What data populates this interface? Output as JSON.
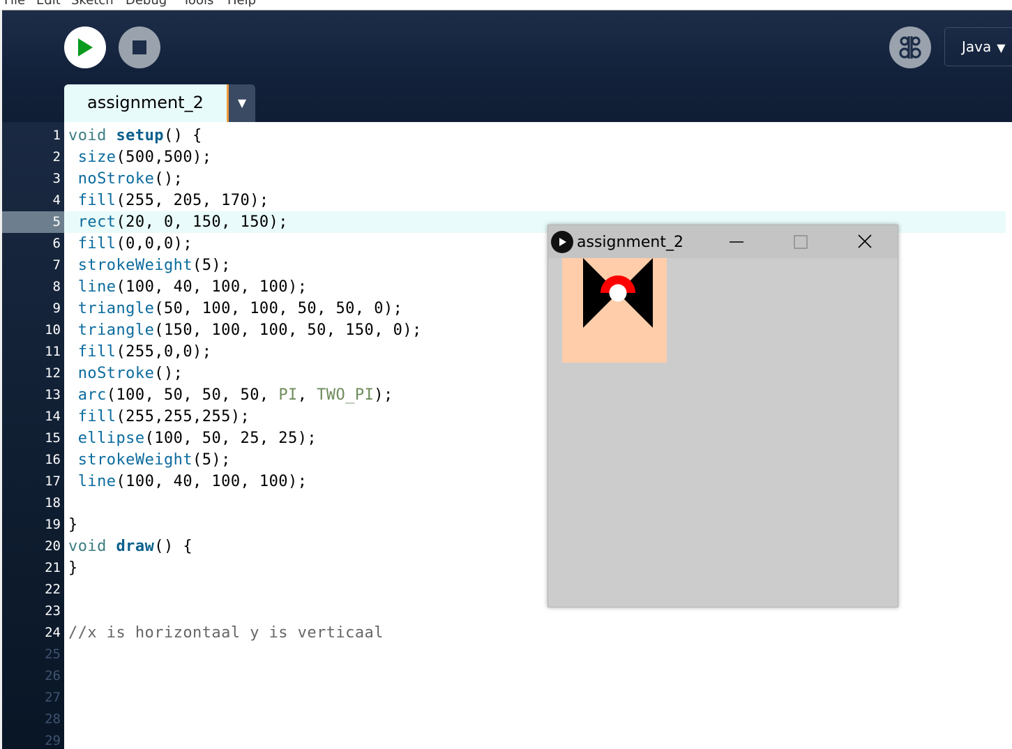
{
  "menubar": {
    "items": [
      "File",
      "Edit",
      "Sketch",
      "Debug",
      "Tools",
      "Help"
    ]
  },
  "toolbar": {
    "run_icon": "play-icon",
    "stop_icon": "stop-icon",
    "debug_icon": "butterfly-icon",
    "mode": "Java",
    "mode_arrow": "▼"
  },
  "tab": {
    "label": "assignment_2",
    "menu_arrow": "▼"
  },
  "editor": {
    "current_line": 5,
    "line_numbers": [
      "1",
      "2",
      "3",
      "4",
      "5",
      "6",
      "7",
      "8",
      "9",
      "10",
      "11",
      "12",
      "13",
      "14",
      "15",
      "16",
      "17",
      "18",
      "19",
      "20",
      "21",
      "22",
      "23",
      "24",
      "25",
      "26",
      "27",
      "28",
      "29"
    ],
    "lines": [
      "void setup() {",
      " size(500,500);",
      " noStroke();",
      " fill(255, 205, 170);",
      " rect(20, 0, 150, 150);",
      " fill(0,0,0);",
      " strokeWeight(5);",
      " line(100, 40, 100, 100);",
      " triangle(50, 100, 100, 50, 50, 0);",
      " triangle(150, 100, 100, 50, 150, 0);",
      " fill(255,0,0);",
      " noStroke();",
      " arc(100, 50, 50, 50, PI, TWO_PI);",
      " fill(255,255,255);",
      " ellipse(100, 50, 25, 25);",
      " strokeWeight(5);",
      " line(100, 40, 100, 100);",
      "",
      "}",
      "void draw() {",
      "}",
      "",
      "",
      "//x is horizontaal y is verticaal"
    ]
  },
  "sketch_window": {
    "title": "assignment_2",
    "icon": "processing-play-icon",
    "controls": [
      "minimize-icon",
      "maximize-icon",
      "close-icon"
    ],
    "background_color": "#cccccc",
    "skin_color": "#ffcdaa",
    "arc_color": "#ff0000"
  },
  "colors": {
    "header": "#12213a",
    "tab_bg": "#e8fbfb",
    "tab_accent": "#ef9b41",
    "current_line": "#e9fbfa",
    "keyword": "#3d7d82",
    "function": "#0b6b9e",
    "constant": "#6e8c5c",
    "comment": "#666666"
  }
}
